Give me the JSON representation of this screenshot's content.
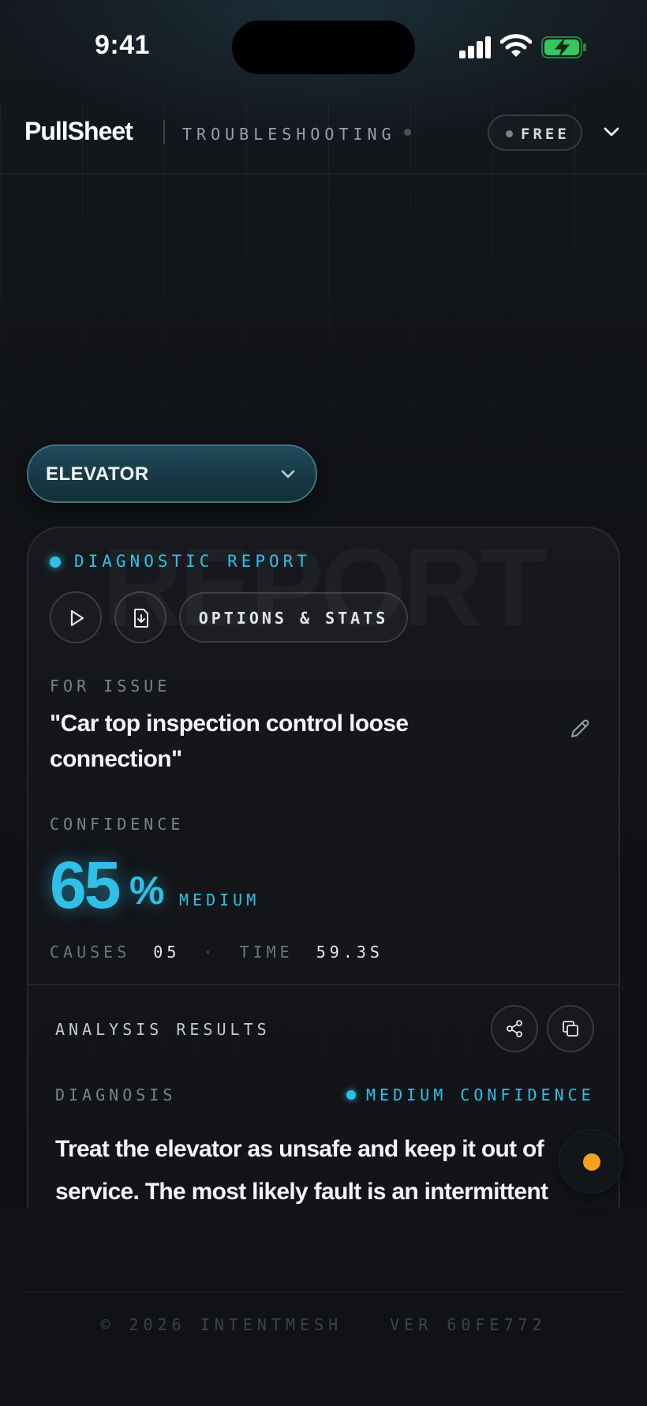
{
  "status_bar": {
    "time": "9:41"
  },
  "header": {
    "brand": "PullSheet",
    "section": "TROUBLESHOOTING",
    "plan_badge": "FREE"
  },
  "equipment_selector": {
    "value": "ELEVATOR"
  },
  "report": {
    "watermark": "REPORT",
    "title": "DIAGNOSTIC REPORT",
    "options_label": "OPTIONS & STATS",
    "issue_label": "FOR ISSUE",
    "issue_text": "\"Car top inspection control loose connection\"",
    "confidence_label": "CONFIDENCE",
    "confidence_value": "65",
    "confidence_unit": "%",
    "confidence_level": "MEDIUM",
    "stats": {
      "causes_label": "CAUSES",
      "causes_value": "05",
      "separator": "·",
      "time_label": "TIME",
      "time_value": "59.3S"
    }
  },
  "analysis": {
    "title": "ANALYSIS RESULTS",
    "diagnosis_label": "DIAGNOSIS",
    "confidence_tag": "MEDIUM CONFIDENCE",
    "diagnosis_text": "Treat the elevator as unsafe and keep it out of service. The most likely fault is an intermittent or open connection at the car-top inspection control terminal, cable, connector, or switch."
  },
  "footer": {
    "copyright": "© 2026 INTENTMESH",
    "version": "VER 60FE772"
  },
  "colors": {
    "accent": "#2ec0e6",
    "status_indicator": "#f2a21b",
    "background": "#101216"
  },
  "icons": {
    "play": "play-icon",
    "download": "download-file-icon",
    "edit": "pencil-icon",
    "share": "share-icon",
    "copy": "copy-icon"
  }
}
